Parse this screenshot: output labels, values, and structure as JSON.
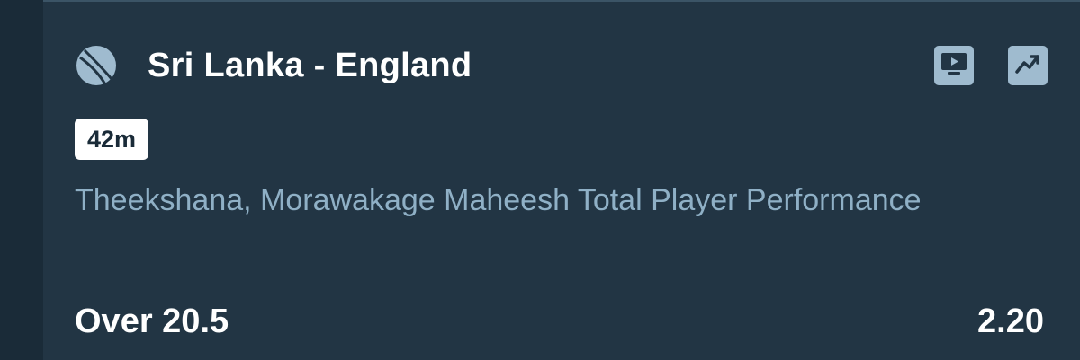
{
  "match": {
    "title": "Sri Lanka - England",
    "sport_icon": "cricket-ball-icon"
  },
  "actions": {
    "stream_icon": "live-stream-tv-icon",
    "stats_icon": "statistics-trend-icon"
  },
  "time_badge": "42m",
  "market": {
    "name": "Theekshana, Morawakage Maheesh Total Player Performance"
  },
  "selection": {
    "name": "Over 20.5",
    "odds": "2.20"
  },
  "colors": {
    "background": "#1a2b38",
    "card": "#223544",
    "icon_fill": "#9fbbcf",
    "market_text": "#8fb0c6",
    "primary_text": "#ffffff"
  }
}
